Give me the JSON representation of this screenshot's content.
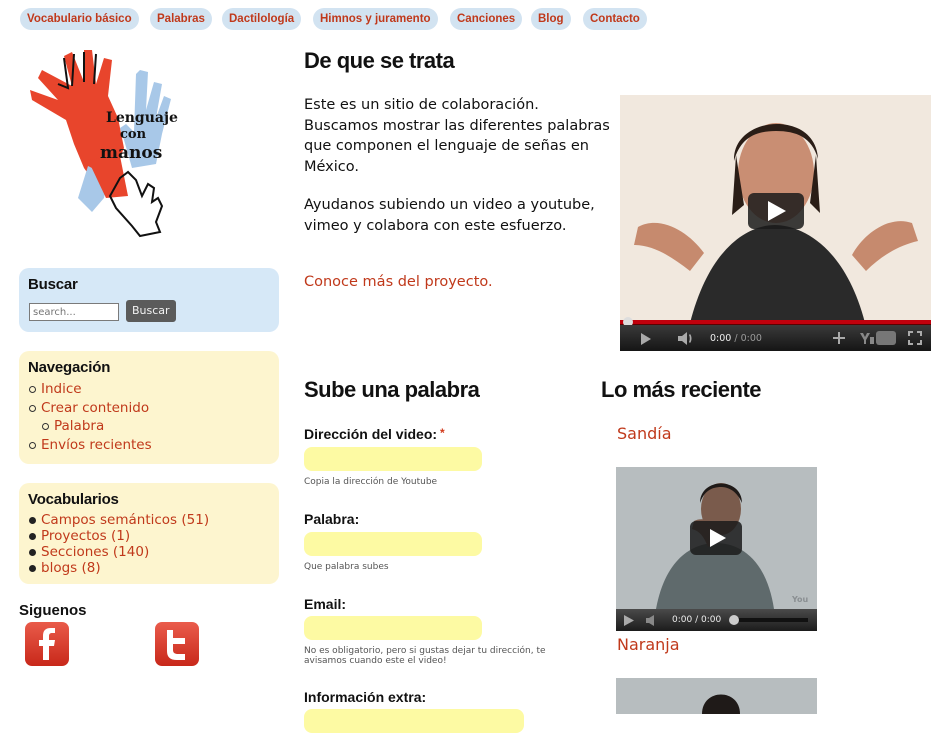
{
  "nav": [
    "Vocabulario básico",
    "Palabras",
    "Dactilología",
    "Himnos y juramento",
    "Canciones",
    "Blog",
    "Contacto"
  ],
  "logo": {
    "line1": "Lenguaje",
    "line2": "con",
    "line3": "manos"
  },
  "search": {
    "title": "Buscar",
    "placeholder": "search...",
    "button": "Buscar"
  },
  "navigation": {
    "title": "Navegación",
    "items": [
      "Indice",
      "Crear contenido",
      "Palabra",
      "Envíos recientes"
    ]
  },
  "vocabularies": {
    "title": "Vocabularios",
    "items": [
      "Campos semánticos (51)",
      "Proyectos (1)",
      "Secciones (140)",
      "blogs (8)"
    ]
  },
  "follow": {
    "title": "Siguenos"
  },
  "about": {
    "title": "De que se trata",
    "p1": "Este es un sitio de colaboración. Buscamos mostrar las diferentes palabras que componen el lenguaje de señas en México.",
    "p2": "Ayudanos subiendo un video a youtube, vimeo y colabora con este esfuerzo.",
    "more_link": "Conoce más del proyecto."
  },
  "video_main": {
    "time_current": "0:00",
    "time_total": "/ 0:00"
  },
  "upload": {
    "title": "Sube una palabra",
    "video_label": "Dirección del video:",
    "required_mark": "*",
    "video_help": "Copia la dirección de Youtube",
    "word_label": "Palabra:",
    "word_help": "Que palabra subes",
    "email_label": "Email:",
    "email_help": "No es obligatorio, pero si gustas dejar tu dirección, te avisamos cuando este el video!",
    "extra_label": "Información extra:"
  },
  "recent": {
    "title": "Lo más reciente",
    "items": [
      "Sandía",
      "Naranja"
    ],
    "video_time": "0:00 / 0:00"
  },
  "colors": {
    "accent": "#c0391b",
    "nav_pill": "#d2e3f1",
    "search_box": "#d6e8f7",
    "sidebar_box": "#fdf5cf",
    "input": "#fdfaa3"
  }
}
